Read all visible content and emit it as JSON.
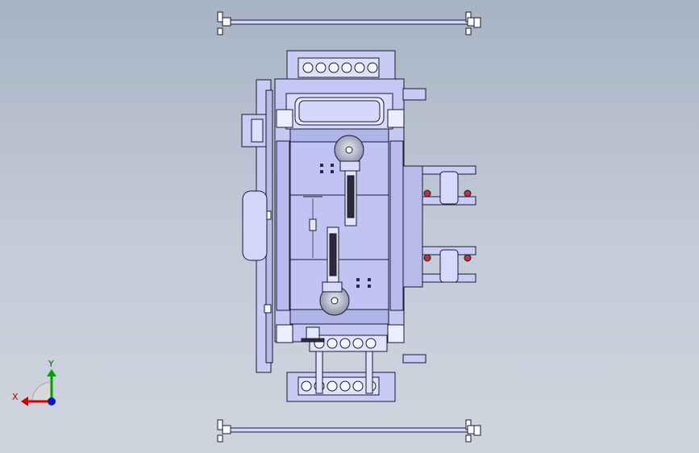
{
  "view": {
    "background_top": "#a7b3c4",
    "background_bottom": "#cfd5de",
    "part_fill": "#c8ccf4",
    "part_fill_dark": "#aab0e6",
    "line_color": "#1a1a2e"
  },
  "triad": {
    "x_label": "X",
    "y_label": "Y",
    "x_color": "#d40000",
    "y_color": "#00a000",
    "z_color": "#1010c0"
  }
}
